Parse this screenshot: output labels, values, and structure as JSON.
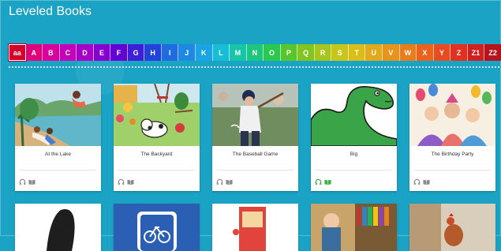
{
  "header": {
    "title": "Leveled Books"
  },
  "levels": {
    "items": [
      {
        "label": "aa",
        "color": "#d4002a",
        "selected": true
      },
      {
        "label": "A",
        "color": "#e2007a"
      },
      {
        "label": "B",
        "color": "#d9009b"
      },
      {
        "label": "C",
        "color": "#c400b9"
      },
      {
        "label": "D",
        "color": "#a600c9"
      },
      {
        "label": "E",
        "color": "#8600d0"
      },
      {
        "label": "F",
        "color": "#6300d4"
      },
      {
        "label": "G",
        "color": "#3d1fd8"
      },
      {
        "label": "H",
        "color": "#2342db"
      },
      {
        "label": "I",
        "color": "#1f6be0"
      },
      {
        "label": "J",
        "color": "#1f88e4"
      },
      {
        "label": "K",
        "color": "#1aa3e6"
      },
      {
        "label": "L",
        "color": "#17bcd6"
      },
      {
        "label": "M",
        "color": "#17c6a8"
      },
      {
        "label": "N",
        "color": "#1cc77d"
      },
      {
        "label": "O",
        "color": "#2bc84f"
      },
      {
        "label": "P",
        "color": "#56c62c"
      },
      {
        "label": "Q",
        "color": "#82c51e"
      },
      {
        "label": "R",
        "color": "#a9c51b"
      },
      {
        "label": "S",
        "color": "#c8c51a"
      },
      {
        "label": "T",
        "color": "#dbbd1a"
      },
      {
        "label": "U",
        "color": "#e3a91a"
      },
      {
        "label": "V",
        "color": "#e8941a"
      },
      {
        "label": "W",
        "color": "#eb7c1b"
      },
      {
        "label": "X",
        "color": "#ec621d"
      },
      {
        "label": "Y",
        "color": "#ea4a1f"
      },
      {
        "label": "Z",
        "color": "#e2321f"
      },
      {
        "label": "Z1",
        "color": "#d21f1f"
      },
      {
        "label": "Z2",
        "color": "#b8121c"
      }
    ]
  },
  "books": [
    {
      "title": "At the Lake",
      "icons": "grey"
    },
    {
      "title": "The Backyard",
      "icons": "grey"
    },
    {
      "title": "The Baseball Game",
      "icons": "grey"
    },
    {
      "title": "Big",
      "icons": "green"
    },
    {
      "title": "The Birthday Party",
      "icons": "grey"
    }
  ],
  "icons": {
    "listen": "headphones-icon",
    "read": "book-icon"
  }
}
